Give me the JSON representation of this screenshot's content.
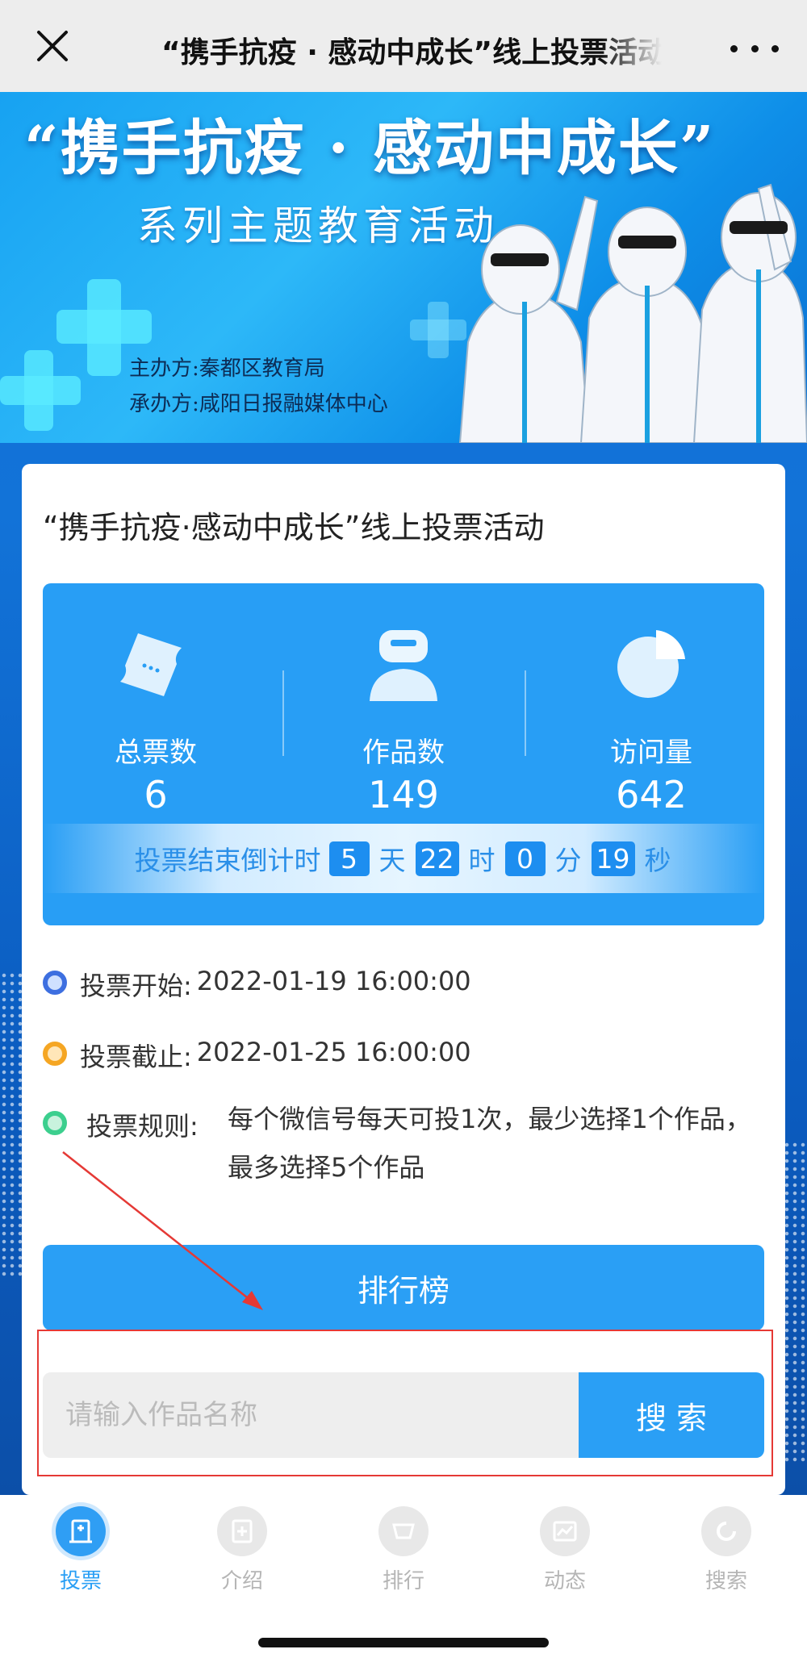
{
  "topbar": {
    "title": "“携手抗疫 · 感动中成长”线上投票活动"
  },
  "banner": {
    "title": "“携手抗疫 · 感动中成长”",
    "subtitle": "系列主题教育活动",
    "organizer": "主办方:秦都区教育局",
    "undertaker": "承办方:咸阳日报融媒体中心"
  },
  "card": {
    "title": "“携手抗疫·感动中成长”线上投票活动"
  },
  "stats": [
    {
      "icon": "ticket-icon",
      "label": "总票数",
      "value": "6"
    },
    {
      "icon": "works-icon",
      "label": "作品数",
      "value": "149"
    },
    {
      "icon": "pie-chart-icon",
      "label": "访问量",
      "value": "642"
    }
  ],
  "countdown": {
    "prefix": "投票结束倒计时",
    "days": "5",
    "days_unit": "天",
    "hours": "22",
    "hours_unit": "时",
    "minutes": "0",
    "minutes_unit": "分",
    "seconds": "19",
    "seconds_unit": "秒"
  },
  "info": {
    "start_label": "投票开始:",
    "start_value": "2022-01-19 16:00:00",
    "end_label": "投票截止:",
    "end_value": "2022-01-25 16:00:00",
    "rule_label": "投票规则:",
    "rule_value": "每个微信号每天可投1次，最少选择1个作品，最多选择5个作品"
  },
  "buttons": {
    "ranking": "排行榜",
    "search": "搜 索"
  },
  "search": {
    "placeholder": "请输入作品名称",
    "value": ""
  },
  "tabs": [
    {
      "icon": "vote-icon",
      "label": "投票",
      "active": true
    },
    {
      "icon": "intro-icon",
      "label": "介绍",
      "active": false
    },
    {
      "icon": "ranking-icon",
      "label": "排行",
      "active": false
    },
    {
      "icon": "activity-icon",
      "label": "动态",
      "active": false
    },
    {
      "icon": "search-icon",
      "label": "搜索",
      "active": false
    }
  ],
  "colors": {
    "accent": "#2a9ff5",
    "start_dot": "#3d6fe0",
    "end_dot": "#f5a623",
    "rule_dot": "#3ccf8e",
    "annotation": "#e53935"
  }
}
